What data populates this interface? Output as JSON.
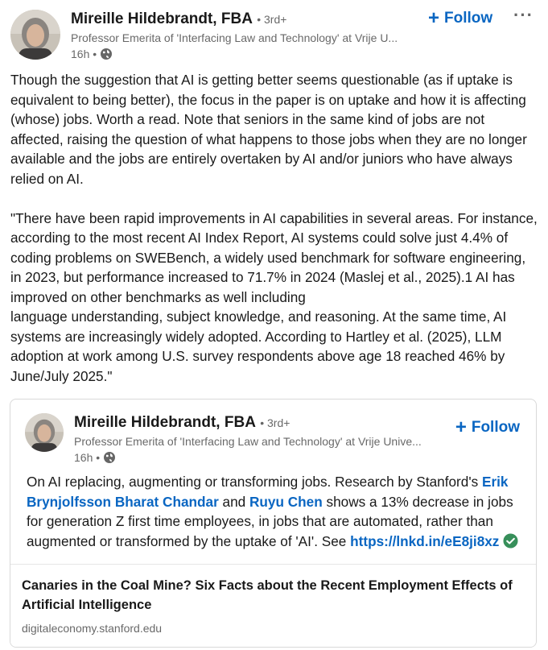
{
  "post": {
    "author": {
      "name": "Mireille Hildebrandt, FBA",
      "degree": "• 3rd+",
      "headline": "Professor Emerita of 'Interfacing Law and Technology' at Vrije U...",
      "time": "16h •",
      "visibility_icon": "globe-icon"
    },
    "follow_label": "Follow",
    "more_label": "···",
    "body": [
      "Though the suggestion that AI is getting better seems questionable (as if uptake is equivalent to being better), the focus in the paper is on uptake and how it is affecting (whose) jobs. Worth a read. Note that seniors in the same kind of jobs are not affected, raising the question of what happens to those jobs when they are no longer available and the jobs are entirely overtaken by AI and/or juniors who have always relied on AI.",
      "\"There have been rapid improvements in AI capabilities in several areas. For instance, according to the most recent AI Index Report, AI systems could solve just 4.4% of coding problems on SWEBench, a widely used benchmark for software engineering, in 2023, but performance increased to 71.7% in 2024 (Maslej et al., 2025).1 AI has improved on other benchmarks as well including",
      "language understanding, subject knowledge, and reasoning. At the same time, AI systems are increasingly widely adopted. According to Hartley et al. (2025), LLM adoption at work among U.S. survey respondents above age 18 reached 46% by June/July 2025.\""
    ]
  },
  "shared": {
    "author": {
      "name": "Mireille Hildebrandt, FBA",
      "degree": "• 3rd+",
      "headline": "Professor Emerita of 'Interfacing Law and Technology' at Vrije Unive...",
      "time": "16h •"
    },
    "follow_label": "Follow",
    "text_1": "On AI replacing, augmenting or transforming jobs. Research by Stanford's ",
    "mention_1": "Erik Brynjolfsson Bharat Chandar",
    "text_2": " and ",
    "mention_2": "Ruyu Chen",
    "text_3": " shows a 13% decrease in jobs for generation Z first time employees, in jobs that are automated, rather than augmented or transformed by the uptake of 'AI'. See ",
    "link": "https://lnkd.in/eE8ji8xz",
    "article": {
      "title": "Canaries in the Coal Mine? Six Facts about the Recent Employment Effects of Artificial Intelligence",
      "source": "digitaleconomy.stanford.edu"
    }
  },
  "colors": {
    "accent": "#0a66c2",
    "verified": "#378f5a"
  }
}
